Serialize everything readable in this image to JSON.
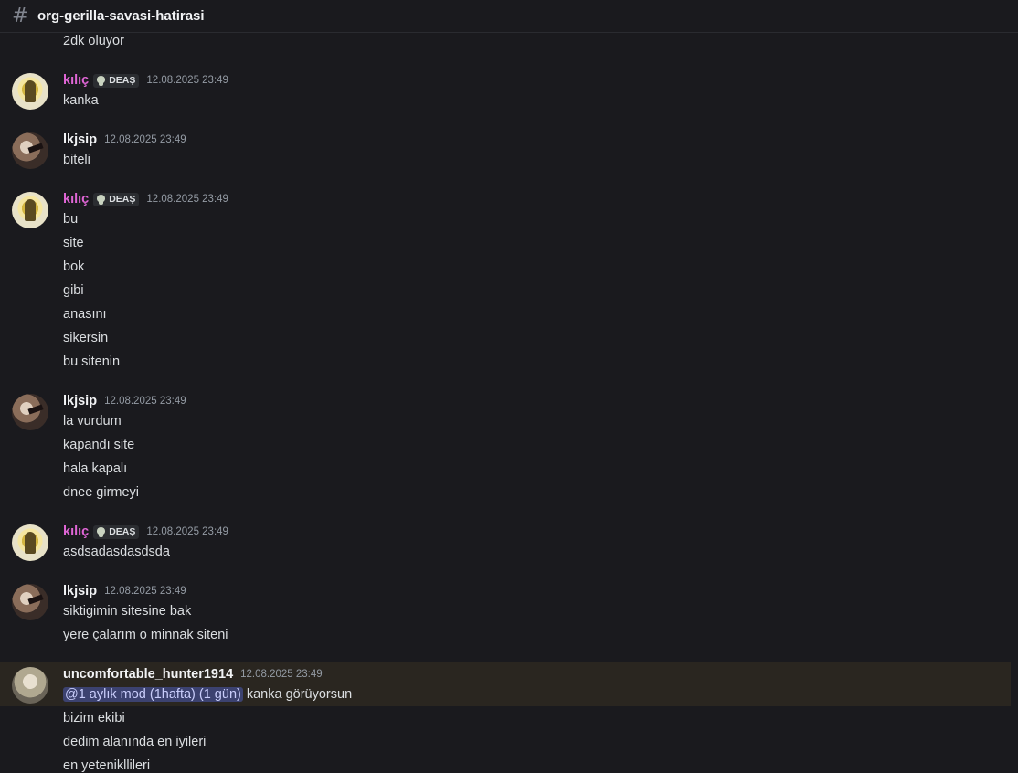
{
  "channel": {
    "name": "org-gerilla-savasi-hatirasi"
  },
  "messages": [
    {
      "continuation": true,
      "lines": [
        "2dk oluyor"
      ]
    },
    {
      "author": "kılıç",
      "tag": "DEAŞ",
      "timestamp": "12.08.2025 23:49",
      "lines": [
        "kanka"
      ]
    },
    {
      "author": "lkjsip",
      "timestamp": "12.08.2025 23:49",
      "lines": [
        "biteli"
      ]
    },
    {
      "author": "kılıç",
      "tag": "DEAŞ",
      "timestamp": "12.08.2025 23:49",
      "lines": [
        "bu",
        "site",
        "bok",
        "gibi",
        "anasını",
        "sikersin",
        "bu sitenin"
      ]
    },
    {
      "author": "lkjsip",
      "timestamp": "12.08.2025 23:49",
      "lines": [
        "la vurdum",
        "kapandı site",
        "hala kapalı",
        "dnee girmeyi"
      ]
    },
    {
      "author": "kılıç",
      "tag": "DEAŞ",
      "timestamp": "12.08.2025 23:49",
      "lines": [
        "asdsadasdasdsda"
      ]
    },
    {
      "author": "lkjsip",
      "timestamp": "12.08.2025 23:49",
      "lines": [
        "siktigimin sitesine bak",
        "yere çalarım o minnak siteni"
      ]
    },
    {
      "author": "uncomfortable_hunter1914",
      "timestamp": "12.08.2025 23:49",
      "mention": "@1 aylık mod (1hafta) (1 gün)",
      "mention_rest": " kanka görüyorsun",
      "lines": [
        "bizim ekibi",
        "dedim alanında en iyileri",
        "en yetenikllileri"
      ]
    }
  ]
}
